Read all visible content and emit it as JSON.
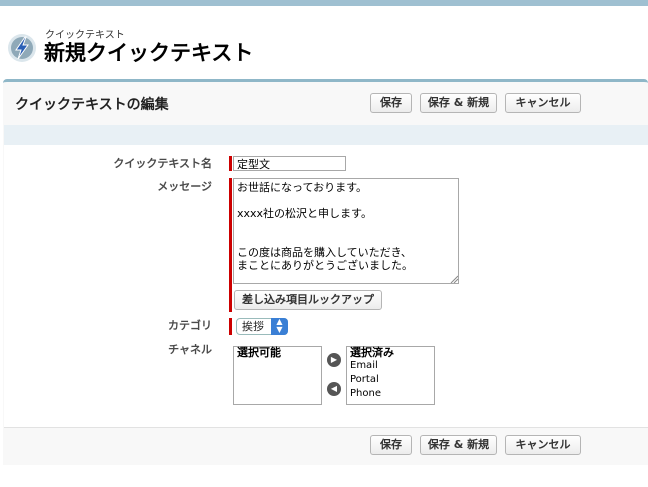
{
  "header": {
    "subtitle": "クイックテキスト",
    "title": "新規クイックテキスト",
    "icon": "lightning-icon"
  },
  "panel": {
    "title": "クイックテキストの編集"
  },
  "buttons": {
    "save": "保存",
    "save_new": "保存 & 新規",
    "cancel": "キャンセル"
  },
  "form": {
    "name_label": "クイックテキスト名",
    "name_value": "定型文",
    "message_label": "メッセージ",
    "message_value": "お世話になっております。\n\nxxxx社の松沢と申します。\n\n\nこの度は商品を購入していただき、\nまことにありがとうございました。",
    "merge_field_button": "差し込み項目ルックアップ",
    "category_label": "カテゴリ",
    "category_value": "挨拶",
    "channel_label": "チャネル",
    "available_label": "選択可能",
    "selected_label": "選択済み",
    "selected_items": [
      "Email",
      "Portal",
      "Phone"
    ]
  },
  "colors": {
    "required_bar": "#cc0000",
    "panel_border": "#8fb7c8",
    "select_arrow": "#3a7fd5"
  }
}
